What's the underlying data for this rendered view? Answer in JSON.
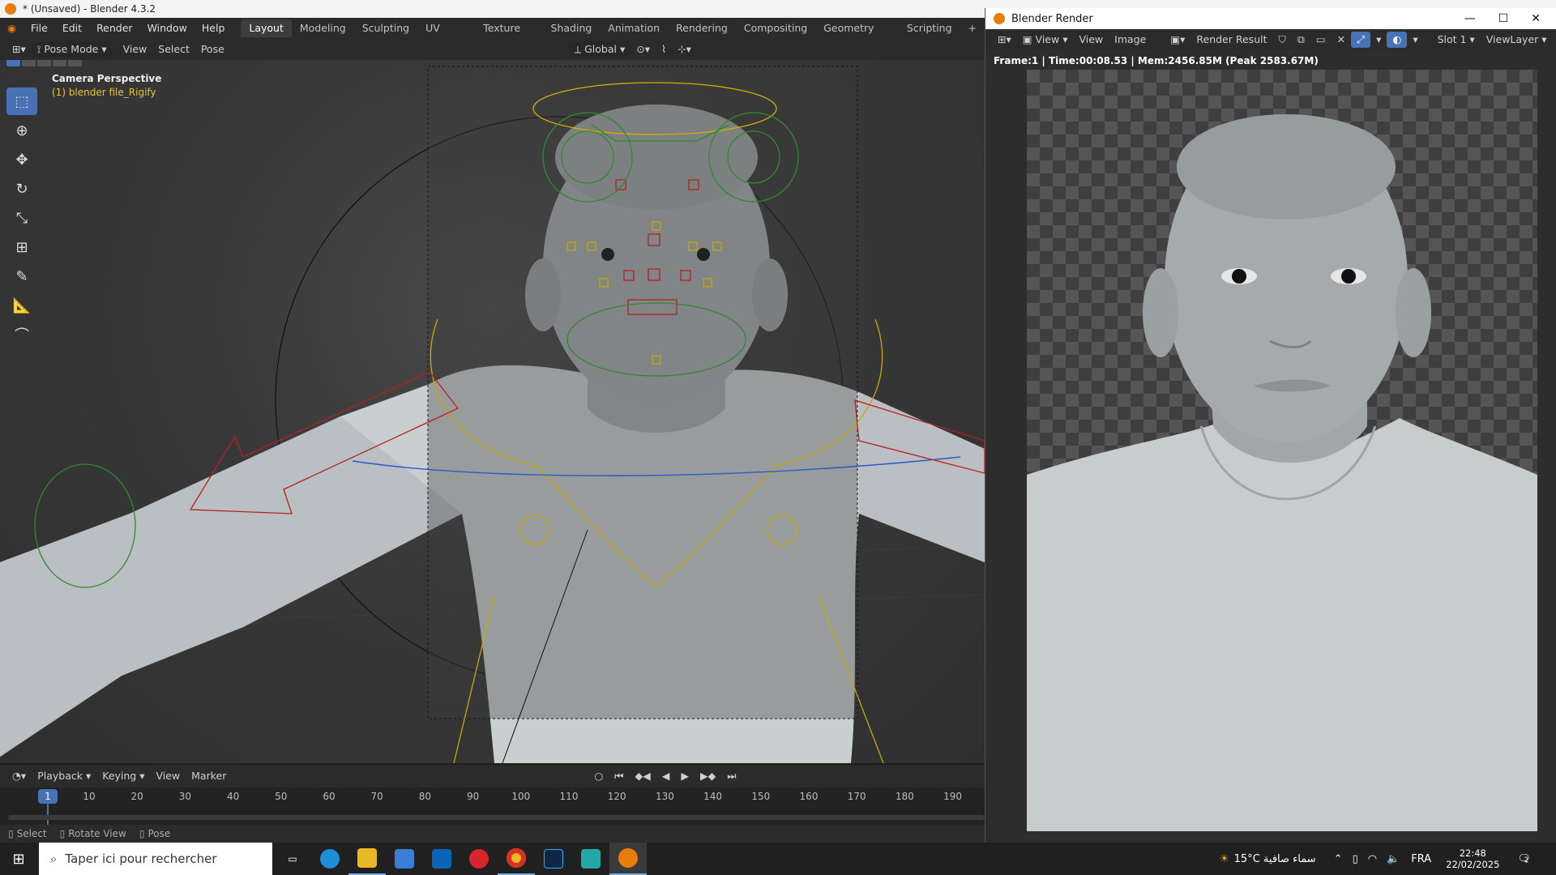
{
  "window_title": "* (Unsaved) - Blender 4.3.2",
  "menus": [
    "File",
    "Edit",
    "Render",
    "Window",
    "Help"
  ],
  "workspaces": [
    "Layout",
    "Modeling",
    "Sculpting",
    "UV Editing",
    "Texture Paint",
    "Shading",
    "Animation",
    "Rendering",
    "Compositing",
    "Geometry Nodes",
    "Scripting"
  ],
  "active_workspace": "Layout",
  "viewport_header": {
    "mode": "Pose Mode",
    "menus": [
      "View",
      "Select",
      "Pose"
    ],
    "orientation": "Global"
  },
  "viewport": {
    "camera_label": "Camera Perspective",
    "object_label": "(1) blender file_Rigify"
  },
  "render_window": {
    "title": "Blender Render",
    "toolbar": {
      "view": "View",
      "view2": "View",
      "image": "Image",
      "result": "Render Result",
      "slot": "Slot 1",
      "layer": "ViewLayer"
    },
    "stats": "Frame:1 | Time:00:08.53 | Mem:2456.85M (Peak 2583.67M)"
  },
  "timeline": {
    "menus": [
      "Playback",
      "Keying",
      "View",
      "Marker"
    ],
    "current_frame": "1",
    "ticks": [
      "10",
      "20",
      "30",
      "40",
      "50",
      "60",
      "70",
      "80",
      "90",
      "100",
      "110",
      "120",
      "130",
      "140",
      "150",
      "160",
      "170",
      "180",
      "190"
    ]
  },
  "statusbar": {
    "select": "Select",
    "rotate": "Rotate View",
    "pose": "Pose"
  },
  "taskbar": {
    "search_placeholder": "Taper ici pour rechercher",
    "weather": "15°C  سماء صافية",
    "language": "FRA",
    "time": "22:48",
    "date": "22/02/2025",
    "notifications": "2"
  },
  "colors": {
    "accent": "#4772b3",
    "blender_orange": "#e87d0d"
  }
}
